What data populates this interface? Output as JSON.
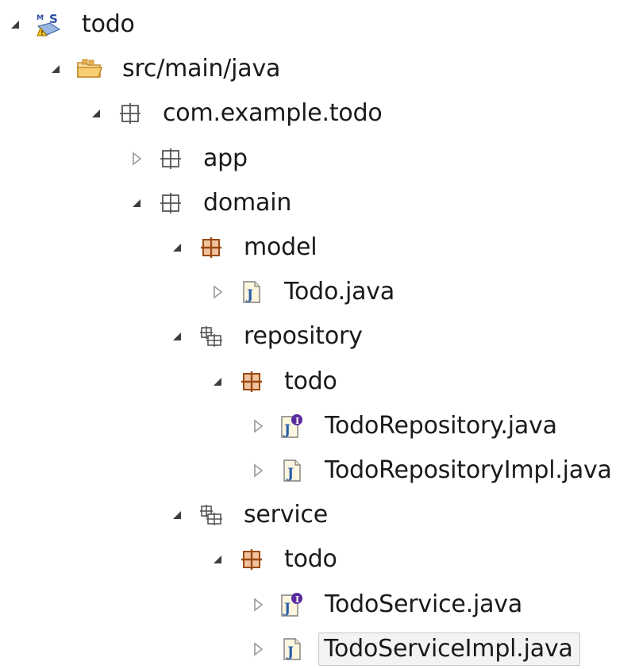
{
  "colors": {
    "twistie": "#3d3d3d",
    "twistie_collapsed": "#9a9a9a",
    "package_outline": "#555555",
    "package_brown": "#9b4a12",
    "package_brown_fill": "#f0c39e",
    "folder": "#c58a2a",
    "java_file_blue": "#2a5fa8",
    "interface_purple": "#5a2a9e"
  },
  "tree": [
    {
      "label": "todo",
      "depth": 0,
      "expanded": true,
      "icon": "maven-spring-project-icon"
    },
    {
      "label": "src/main/java",
      "depth": 1,
      "expanded": true,
      "icon": "source-folder-icon"
    },
    {
      "label": "com.example.todo",
      "depth": 2,
      "expanded": true,
      "icon": "package-icon"
    },
    {
      "label": "app",
      "depth": 3,
      "expanded": false,
      "icon": "package-icon"
    },
    {
      "label": "domain",
      "depth": 3,
      "expanded": true,
      "icon": "package-icon"
    },
    {
      "label": "model",
      "depth": 4,
      "expanded": true,
      "icon": "brown-package-icon"
    },
    {
      "label": "Todo.java",
      "depth": 5,
      "expanded": false,
      "icon": "java-class-file-icon"
    },
    {
      "label": "repository",
      "depth": 4,
      "expanded": true,
      "icon": "hierarchical-package-icon"
    },
    {
      "label": "todo",
      "depth": 5,
      "expanded": true,
      "icon": "brown-package-icon"
    },
    {
      "label": "TodoRepository.java",
      "depth": 6,
      "expanded": false,
      "icon": "java-interface-file-icon"
    },
    {
      "label": "TodoRepositoryImpl.java",
      "depth": 6,
      "expanded": false,
      "icon": "java-class-file-icon"
    },
    {
      "label": "service",
      "depth": 4,
      "expanded": true,
      "icon": "hierarchical-package-icon"
    },
    {
      "label": "todo",
      "depth": 5,
      "expanded": true,
      "icon": "brown-package-icon"
    },
    {
      "label": "TodoService.java",
      "depth": 6,
      "expanded": false,
      "icon": "java-interface-file-icon"
    },
    {
      "label": "TodoServiceImpl.java",
      "depth": 6,
      "expanded": false,
      "icon": "java-class-file-icon",
      "selected": true
    }
  ]
}
